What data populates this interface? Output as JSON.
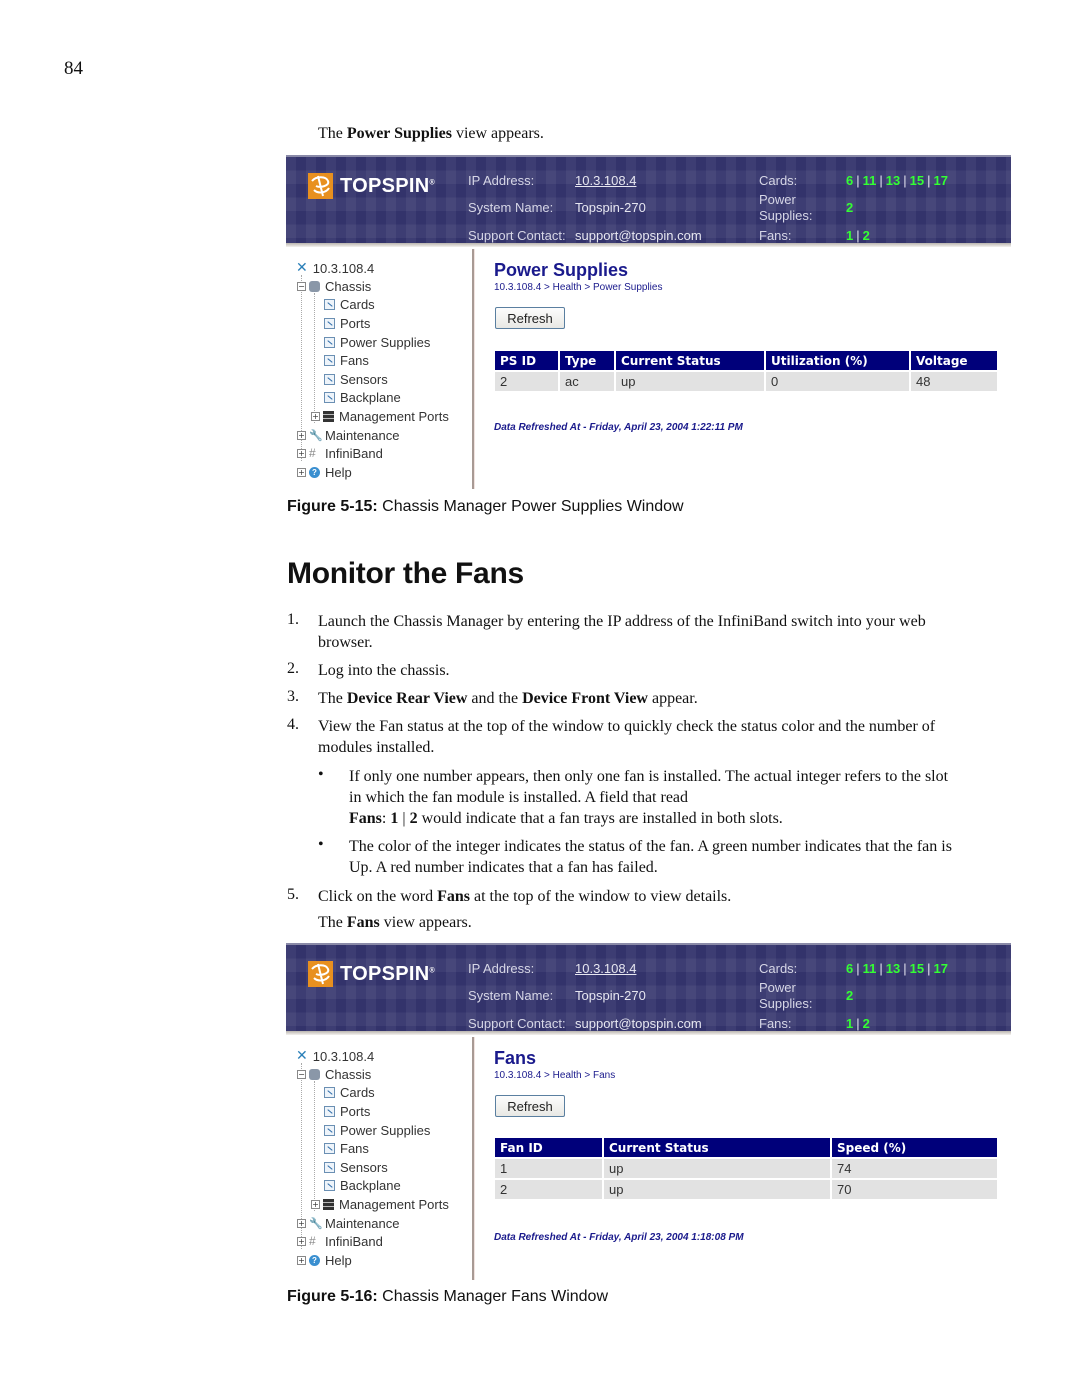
{
  "page_number": "84",
  "intro": {
    "prefix": "The ",
    "bold": "Power Supplies",
    "suffix": " view appears."
  },
  "banner": {
    "logo_text": "TOPSPIN",
    "logo_reg": "®",
    "ip_label": "IP Address:",
    "ip_value": "10.3.108.4",
    "system_label": "System Name:",
    "system_value": "Topspin-270",
    "support_label": "Support Contact:",
    "support_value": "support@topspin.com",
    "cards_label": "Cards:",
    "cards": [
      "6",
      "11",
      "13",
      "15",
      "17"
    ],
    "power_label_1": "Power",
    "power_label_2": "Supplies:",
    "power": [
      "2"
    ],
    "fans_label": "Fans:",
    "fans": [
      "1",
      "2"
    ],
    "status_color": "#33ff33",
    "background_color": "#33336b"
  },
  "tree": {
    "root": "10.3.108.4",
    "chassis": "Chassis",
    "children": [
      "Cards",
      "Ports",
      "Power Supplies",
      "Fans",
      "Sensors",
      "Backplane"
    ],
    "management_ports": "Management Ports",
    "maintenance": "Maintenance",
    "infiniband": "InfiniBand",
    "help": "Help"
  },
  "figure1": {
    "title": "Power Supplies",
    "breadcrumb": "10.3.108.4 > Health > Power Supplies",
    "refresh_label": "Refresh",
    "table": {
      "headers": [
        "PS ID",
        "Type",
        "Current Status",
        "Utilization (%)",
        "Voltage"
      ],
      "rows": [
        [
          "2",
          "ac",
          "up",
          "0",
          "48"
        ]
      ]
    },
    "refreshed": "Data Refreshed At - Friday, April 23, 2004 1:22:11 PM",
    "caption_bold": "Figure 5-15:",
    "caption_text": " Chassis Manager Power Supplies Window"
  },
  "section": {
    "title": "Monitor the Fans",
    "steps": [
      {
        "num": "1.",
        "line1": "Launch the Chassis Manager by entering the IP address of the InfiniBand switch into your web",
        "line2": "browser."
      },
      {
        "num": "2.",
        "line1": "Log into the chassis."
      },
      {
        "num": "3.",
        "pre": "The ",
        "b1": "Device Rear View",
        "mid": " and the ",
        "b2": "Device Front View",
        "post": " appear."
      },
      {
        "num": "4.",
        "line1": "View the Fan status at the top of the window to quickly check the status color and the number of",
        "line2": "modules installed."
      },
      {
        "num": "5.",
        "pre": "Click on the word ",
        "b1": "Fans",
        "post": " at the top of the window to view details."
      }
    ],
    "bullets": [
      {
        "line1": "If only one number appears, then only one fan is installed. The actual integer refers to the slot",
        "line2": "in which the fan module is installed. A field that read",
        "line3_b1": "Fans",
        "line3_t1": ": ",
        "line3_b2": "1",
        "line3_t2": " | ",
        "line3_b3": "2",
        "line3_t3": " would indicate that a fan trays are installed in both slots."
      },
      {
        "line1": "The color of the integer indicates the status of the fan. A green number indicates that the fan is",
        "line2": "Up. A red number indicates that a fan has failed."
      }
    ],
    "bullet_glyph": "•",
    "fans_view": {
      "prefix": "The ",
      "bold": "Fans",
      "suffix": " view appears."
    }
  },
  "figure2": {
    "title": "Fans",
    "breadcrumb": "10.3.108.4 > Health > Fans",
    "refresh_label": "Refresh",
    "table": {
      "headers": [
        "Fan ID",
        "Current Status",
        "Speed (%)"
      ],
      "rows": [
        [
          "1",
          "up",
          "74"
        ],
        [
          "2",
          "up",
          "70"
        ]
      ]
    },
    "refreshed": "Data Refreshed At - Friday, April 23, 2004 1:18:08 PM",
    "caption_bold": "Figure 5-16:",
    "caption_text": " Chassis Manager Fans Window"
  }
}
